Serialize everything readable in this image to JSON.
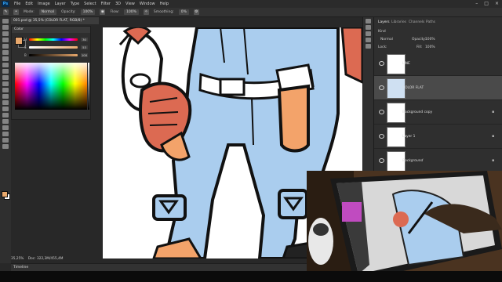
{
  "app": {
    "logo_text": "Ps",
    "menu": [
      "File",
      "Edit",
      "Image",
      "Layer",
      "Type",
      "Select",
      "Filter",
      "3D",
      "View",
      "Window",
      "Help"
    ],
    "window_controls": [
      "–",
      "□",
      "×"
    ]
  },
  "options": {
    "mode_label": "Mode:",
    "mode_value": "Normal",
    "opacity_label": "Opacity:",
    "opacity_value": "100%",
    "flow_label": "Flow:",
    "flow_value": "100%",
    "smoothing_label": "Smoothing:",
    "smoothing_value": "0%"
  },
  "document": {
    "tab_title": "001.psd @ 35,5% (COLOR FLAT, RGB/8) *",
    "zoom": "35,25%",
    "doc_info": "Doc: 322,3M/455,4M"
  },
  "color_panel": {
    "title": "Color",
    "rows": [
      {
        "label": "H",
        "value": "30"
      },
      {
        "label": "S",
        "value": "53"
      },
      {
        "label": "B",
        "value": "100"
      }
    ],
    "foreground": "#e8a86c",
    "background": "#ffffff"
  },
  "layers_panel": {
    "tabs": [
      "Layers",
      "Libraries",
      "Channels",
      "Paths"
    ],
    "kind_label": "Kind",
    "blend_mode": "Normal",
    "opacity_label": "Opacity:",
    "opacity_value": "100%",
    "lock_label": "Lock:",
    "fill_label": "Fill:",
    "fill_value": "100%",
    "layers": [
      {
        "name": "LINE",
        "selected": false,
        "locked": false
      },
      {
        "name": "COLOR FLAT",
        "selected": true,
        "locked": false
      },
      {
        "name": "Background copy",
        "selected": false,
        "locked": true
      },
      {
        "name": "Layer 1",
        "selected": false,
        "locked": true
      },
      {
        "name": "Background",
        "selected": false,
        "locked": true
      }
    ]
  },
  "timeline": {
    "label": "Timeline"
  },
  "colors": {
    "skin_blue": "#aacdee",
    "glove_red": "#dc6a52",
    "pocket_orange": "#f3a36a",
    "line_black": "#111111"
  }
}
